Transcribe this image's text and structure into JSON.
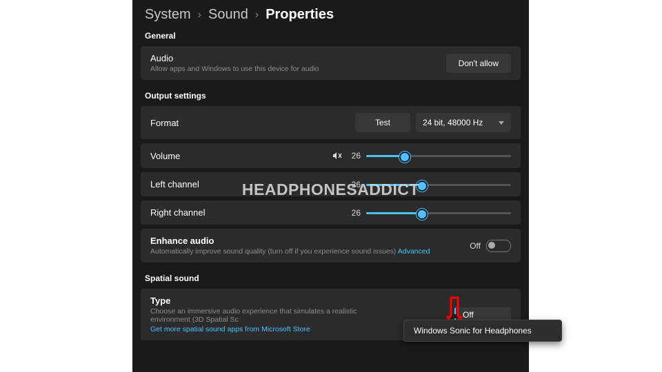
{
  "breadcrumb": {
    "a": "System",
    "b": "Sound",
    "c": "Properties"
  },
  "sections": {
    "general": "General",
    "output": "Output settings",
    "spatial": "Spatial sound"
  },
  "audio": {
    "title": "Audio",
    "sub": "Allow apps and Windows to use this device for audio",
    "btn": "Don't allow"
  },
  "format": {
    "label": "Format",
    "test": "Test",
    "value": "24 bit, 48000 Hz"
  },
  "volume": {
    "label": "Volume",
    "value": "26",
    "percent": 26
  },
  "left": {
    "label": "Left channel",
    "value": "26",
    "percent": 38
  },
  "right": {
    "label": "Right channel",
    "value": "26",
    "percent": 38
  },
  "enhance": {
    "title": "Enhance audio",
    "sub": "Automatically improve sound quality (turn off if you experience sound issues)",
    "adv": "Advanced",
    "state": "Off"
  },
  "spatial": {
    "title": "Type",
    "sub": "Choose an immersive audio experience that simulates a realistic environment (3D Spatial Sc",
    "link": "Get more spatial sound apps from Microsoft Store",
    "value": "Off",
    "popup": "Windows Sonic for Headphones"
  },
  "watermark": {
    "a": "HEADPHONES",
    "b": "ADDICT"
  }
}
